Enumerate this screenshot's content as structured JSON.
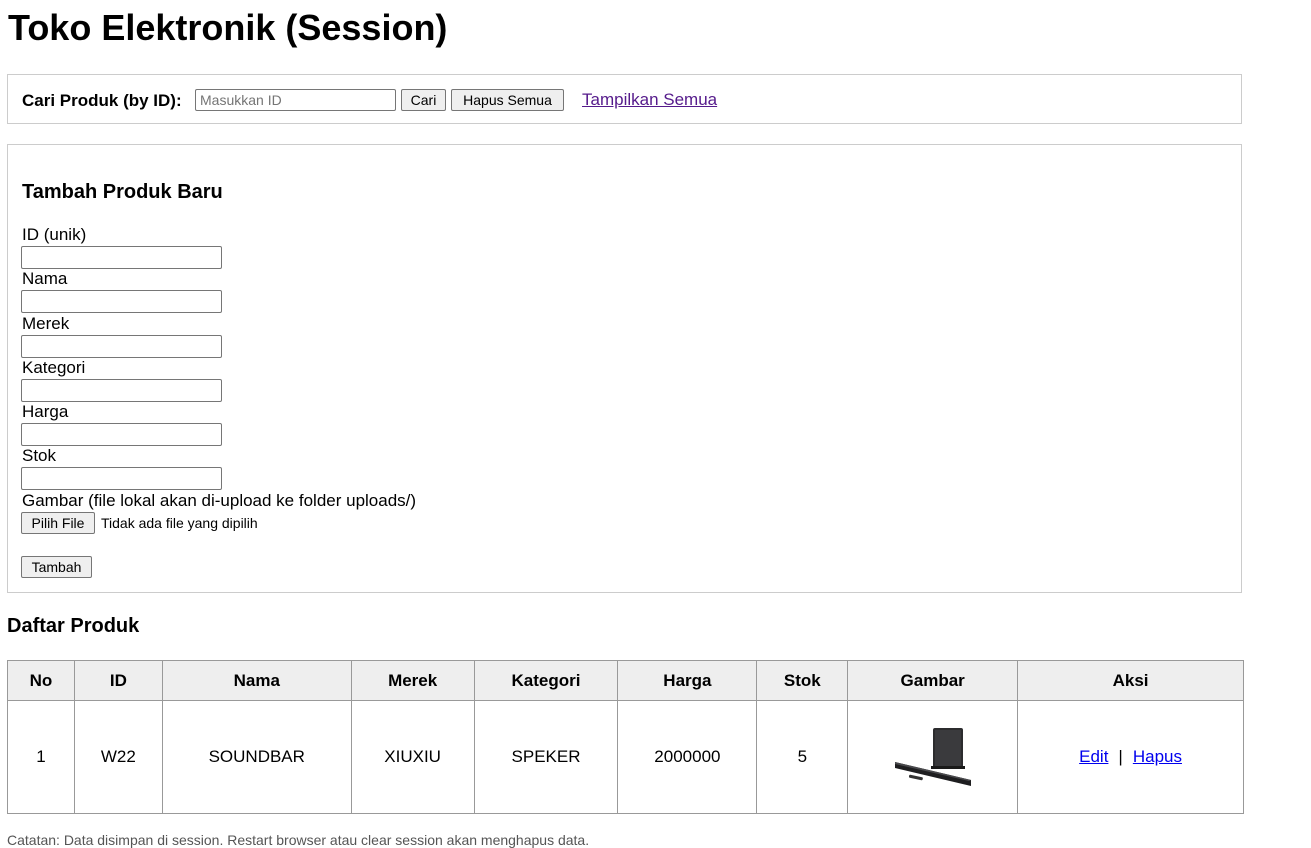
{
  "page": {
    "title": "Toko Elektronik (Session)"
  },
  "search": {
    "label": "Cari Produk (by ID):",
    "placeholder": "Masukkan ID",
    "value": "",
    "search_button": "Cari",
    "clear_button": "Hapus Semua",
    "show_all_link": "Tampilkan Semua"
  },
  "form": {
    "title": "Tambah Produk Baru",
    "fields": [
      {
        "label": "ID (unik)",
        "value": ""
      },
      {
        "label": "Nama",
        "value": ""
      },
      {
        "label": "Merek",
        "value": ""
      },
      {
        "label": "Kategori",
        "value": ""
      },
      {
        "label": "Harga",
        "value": ""
      },
      {
        "label": "Stok",
        "value": ""
      }
    ],
    "image_label": "Gambar (file lokal akan di-upload ke folder uploads/)",
    "file_button": "Pilih File",
    "file_status": "Tidak ada file yang dipilih",
    "submit_button": "Tambah"
  },
  "products": {
    "title": "Daftar Produk",
    "headers": [
      "No",
      "ID",
      "Nama",
      "Merek",
      "Kategori",
      "Harga",
      "Stok",
      "Gambar",
      "Aksi"
    ],
    "rows": [
      {
        "no": "1",
        "id": "W22",
        "nama": "SOUNDBAR",
        "merek": "XIUXIU",
        "kategori": "SPEKER",
        "harga": "2000000",
        "stok": "5",
        "gambar_icon": "soundbar-product-image",
        "edit_link": "Edit",
        "delete_link": "Hapus",
        "separator": "|"
      }
    ]
  },
  "footer": {
    "note": "Catatan: Data disimpan di session. Restart browser atau clear session akan menghapus data."
  }
}
